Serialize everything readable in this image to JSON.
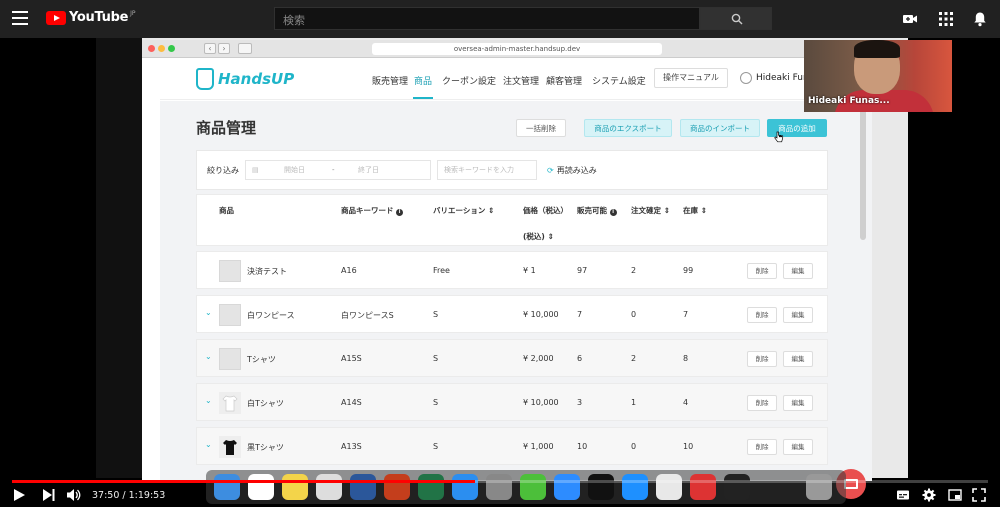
{
  "youtube": {
    "logo_text": "YouTube",
    "logo_region": "JP",
    "search_placeholder": "検索"
  },
  "browser": {
    "url": "oversea-admin-master.handsup.dev"
  },
  "app": {
    "logo": "HandsUP",
    "nav": [
      "販売管理",
      "商品",
      "クーポン設定",
      "注文管理",
      "顧客管理",
      "システム設定"
    ],
    "active_nav": "商品",
    "manual_button": "操作マニュアル",
    "user_name": "Hideaki Funa"
  },
  "page": {
    "title": "商品管理",
    "bulk_delete": "一括削除",
    "export": "商品のエクスポート",
    "import": "商品のインポート",
    "add": "商品の追加"
  },
  "filter": {
    "label": "絞り込み",
    "start_placeholder": "開始日",
    "separator": "-",
    "end_placeholder": "終了日",
    "keyword_placeholder": "検索キーワードを入力",
    "reload": "再読み込み"
  },
  "table": {
    "headers": {
      "product": "商品",
      "keyword": "商品キーワード",
      "variation": "バリエーション ⇕",
      "price": "価格（税込）",
      "price_sub": "(税込) ⇕",
      "sellable": "販売可能",
      "confirmed": "注文確定 ⇕",
      "stock": "在庫 ⇕"
    },
    "delete_label": "削除",
    "edit_label": "編集",
    "rows": [
      {
        "name": "決済テスト",
        "keyword": "A16",
        "variation": "Free",
        "price": "¥ 1",
        "sellable": "97",
        "confirmed": "2",
        "stock": "99"
      },
      {
        "name": "白ワンピース",
        "keyword": "白ワンピースS",
        "variation": "S",
        "price": "¥ 10,000",
        "sellable": "7",
        "confirmed": "0",
        "stock": "7"
      },
      {
        "name": "Tシャツ",
        "keyword": "A15S",
        "variation": "S",
        "price": "¥ 2,000",
        "sellable": "6",
        "confirmed": "2",
        "stock": "8"
      },
      {
        "name": "白Tシャツ",
        "keyword": "A14S",
        "variation": "S",
        "price": "¥ 10,000",
        "sellable": "3",
        "confirmed": "1",
        "stock": "4"
      },
      {
        "name": "黒Tシャツ",
        "keyword": "A13S",
        "variation": "S",
        "price": "¥ 1,000",
        "sellable": "10",
        "confirmed": "0",
        "stock": "10"
      }
    ]
  },
  "webcam": {
    "name": "Hideaki Funas..."
  },
  "player": {
    "time": "37:50 / 1:19:53",
    "progress": 0.474
  },
  "colors": {
    "accent": "#1fb5c9",
    "youtube_red": "#ff0000"
  }
}
